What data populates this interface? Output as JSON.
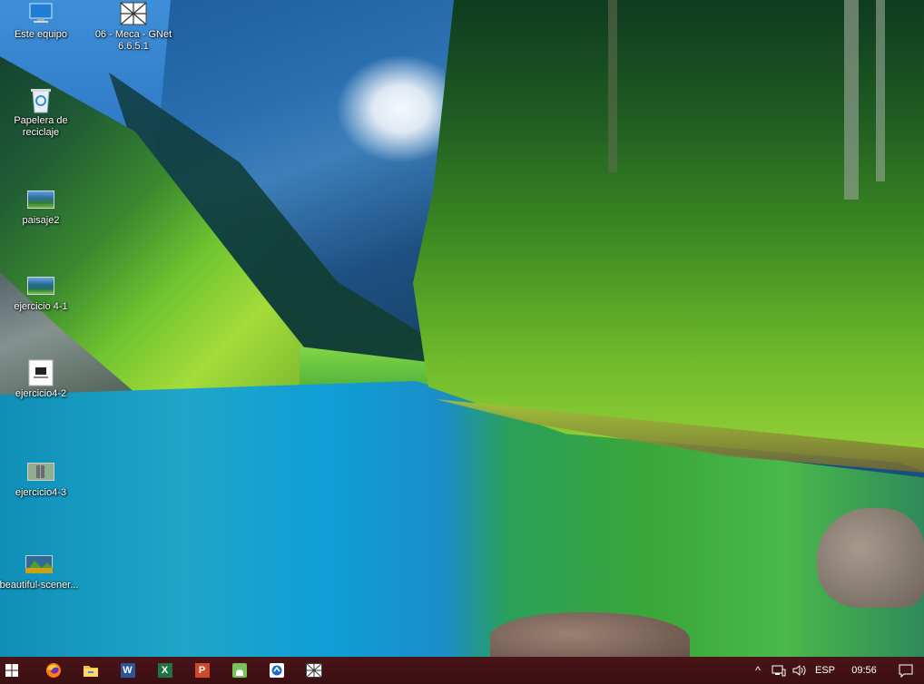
{
  "desktop": {
    "icons": [
      {
        "label": "Este equipo",
        "icon": "this-pc-icon"
      },
      {
        "label": "06 - Meca - GNet 6.6.5.1",
        "line1": "06 - Meca - GNet",
        "line2": "6.6.5.1",
        "icon": "gnet-app-icon"
      },
      {
        "label": "Papelera de reciclaje",
        "line1": "Papelera de",
        "line2": "reciclaje",
        "icon": "recycle-bin-icon"
      },
      {
        "label": "paisaje2",
        "icon": "image-file-icon"
      },
      {
        "label": "ejercicio 4-1",
        "icon": "image-file-icon"
      },
      {
        "label": "ejercicio4-2",
        "icon": "document-file-icon"
      },
      {
        "label": "ejercicio4-3",
        "icon": "image-file-icon"
      },
      {
        "label": "beautiful-scener...",
        "icon": "image-file-icon"
      }
    ]
  },
  "taskbar": {
    "pinned": [
      {
        "name": "start",
        "icon": "windows-logo-icon"
      },
      {
        "name": "firefox",
        "icon": "firefox-icon"
      },
      {
        "name": "file-explorer",
        "icon": "folder-icon"
      },
      {
        "name": "word",
        "icon": "word-icon",
        "letter": "W"
      },
      {
        "name": "excel",
        "icon": "excel-icon",
        "letter": "X"
      },
      {
        "name": "powerpoint",
        "icon": "powerpoint-icon",
        "letter": "P"
      },
      {
        "name": "android-studio",
        "icon": "android-icon"
      },
      {
        "name": "app-blue",
        "icon": "blue-app-icon"
      },
      {
        "name": "gnet",
        "icon": "gnet-app-icon"
      }
    ],
    "tray": {
      "chevron": "^",
      "network_icon": "network-icon",
      "volume_icon": "volume-icon",
      "language": "ESP",
      "time": "09:56",
      "notifications_icon": "notification-icon"
    }
  }
}
